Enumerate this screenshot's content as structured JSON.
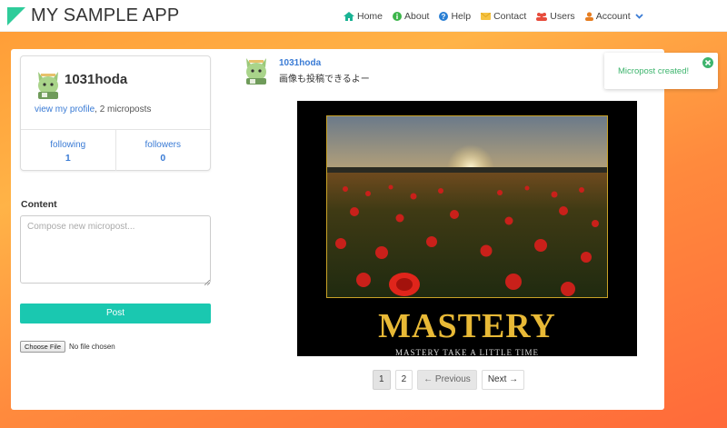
{
  "app": {
    "title": "MY SAMPLE APP"
  },
  "nav": {
    "items": [
      {
        "label": "Home",
        "icon": "home-icon"
      },
      {
        "label": "About",
        "icon": "info-icon"
      },
      {
        "label": "Help",
        "icon": "help-icon"
      },
      {
        "label": "Contact",
        "icon": "mail-icon"
      },
      {
        "label": "Users",
        "icon": "users-icon"
      },
      {
        "label": "Account",
        "icon": "user-icon"
      }
    ]
  },
  "colors": {
    "accent": "#1ac8b0",
    "link": "#3a7bd5",
    "success": "#3db46d"
  },
  "profile": {
    "name": "1031hoda",
    "view_link": "view my profile",
    "microposts": ", 2 microposts",
    "following_label": "following",
    "following_count": "1",
    "followers_label": "followers",
    "followers_count": "0"
  },
  "compose": {
    "label": "Content",
    "placeholder": "Compose new micropost...",
    "post_button": "Post",
    "file_button": "Choose File",
    "file_status": "No file chosen"
  },
  "post": {
    "user": "1031hoda",
    "text": "画像も投稿できるよー",
    "image": {
      "title": "MASTERY",
      "subtitle": "MASTERY TAKE A LITTLE TIME"
    }
  },
  "pagination": {
    "page1": "1",
    "page2": "2",
    "prev": "← Previous",
    "next": "Next →"
  },
  "toast": {
    "message": "Micropost created!"
  }
}
